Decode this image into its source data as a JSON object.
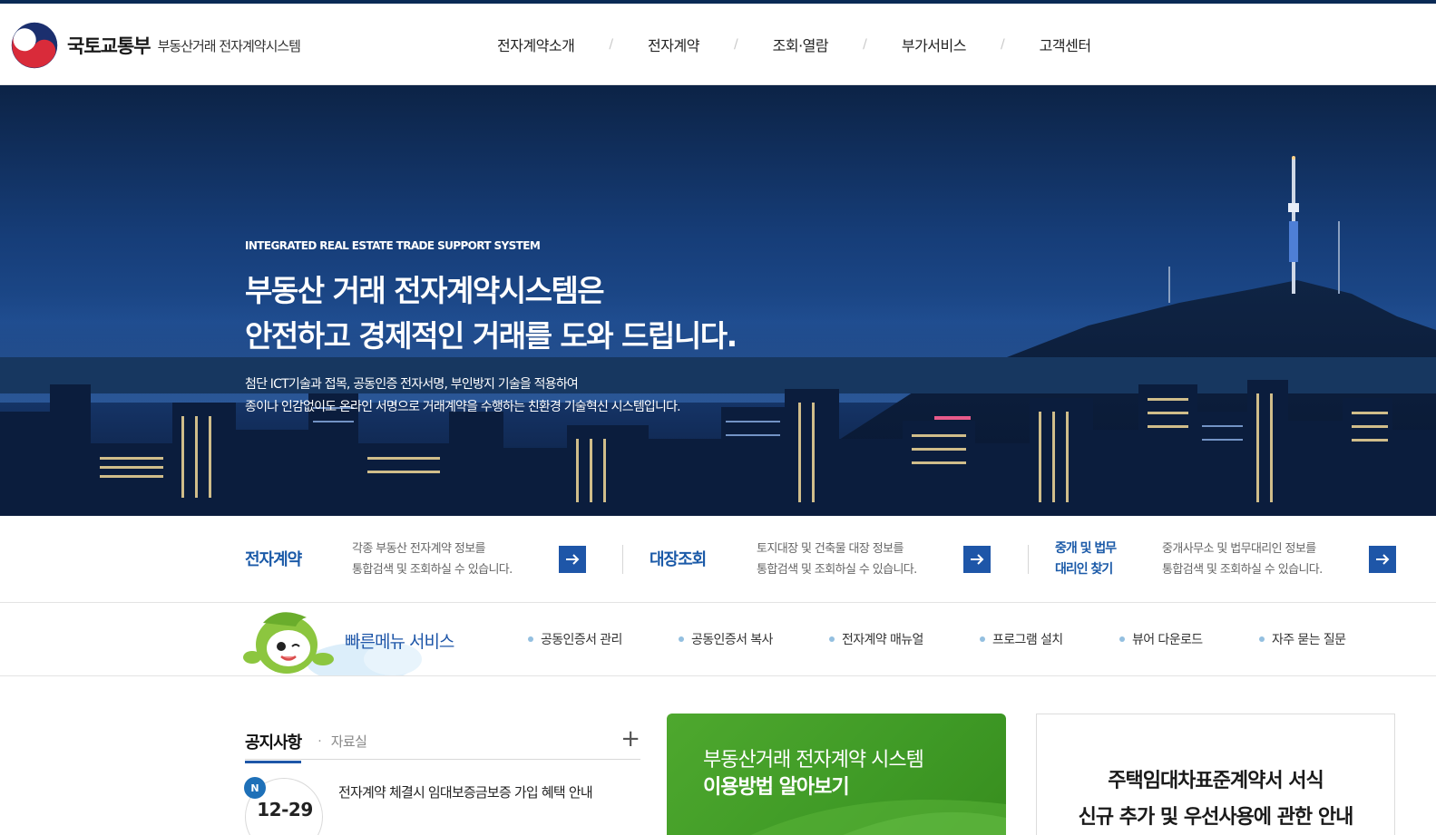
{
  "header": {
    "ministry": "국토교통부",
    "system_name": "부동산거래 전자계약시스템",
    "nav": [
      "전자계약소개",
      "전자계약",
      "조회·열람",
      "부가서비스",
      "고객센터"
    ],
    "nav_separator": "/"
  },
  "hero": {
    "eyebrow": "INTEGRATED REAL ESTATE TRADE SUPPORT SYSTEM",
    "title_line1": "부동산 거래 전자계약시스템은",
    "title_line2": "안전하고 경제적인 거래를 도와 드립니다.",
    "desc_line1": "첨단 ICT기술과 접목, 공동인증 전자서명, 부인방지 기술을 적용하여",
    "desc_line2": "종이나 인감없이도 온라인 서명으로 거래계약을 수행하는 친환경 기술혁신 시스템입니다."
  },
  "quick": [
    {
      "title": "전자계약",
      "desc1": "각종 부동산 전자계약 정보를",
      "desc2": "통합검색 및 조회하실 수 있습니다."
    },
    {
      "title": "대장조회",
      "desc1": "토지대장 및 건축물 대장 정보를",
      "desc2": "통합검색 및 조회하실 수 있습니다."
    },
    {
      "title_line1": "중개 및 법무",
      "title_line2": "대리인 찾기",
      "desc1": "중개사무소 및 법무대리인 정보를",
      "desc2": "통합검색 및 조회하실 수 있습니다."
    }
  ],
  "fastmenu": {
    "title": "빠른메뉴 서비스",
    "links": [
      "공동인증서 관리",
      "공동인증서 복사",
      "전자계약 매뉴얼",
      "프로그램 설치",
      "뷰어 다운로드",
      "자주 묻는 질문"
    ]
  },
  "notice": {
    "tab_active": "공지사항",
    "tab_other": "자료실",
    "more": "+",
    "new_badge": "N",
    "date": "12-29",
    "title": "전자계약 체결시 임대보증금보증 가입 혜택 안내"
  },
  "guide_banner": {
    "line1": "부동산거래 전자계약 시스템",
    "line2": "이용방법 알아보기"
  },
  "lease_box": {
    "line1": "주택임대차표준계약서 서식",
    "line2": "신규 추가 및 우선사용에 관한 안내"
  },
  "colors": {
    "nav_bar": "#0a2a55",
    "accent_blue": "#1e56a8",
    "green_banner": "#4ea82e"
  }
}
